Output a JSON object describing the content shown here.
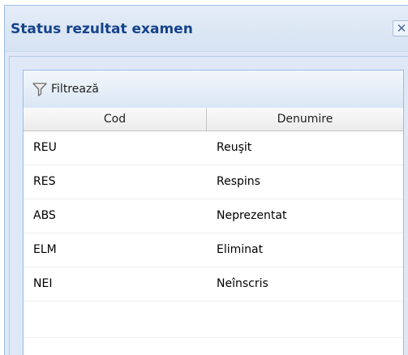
{
  "window": {
    "title": "Status rezultat examen",
    "close_glyph": "✕"
  },
  "toolbar": {
    "filter_label": "Filtrează",
    "filter_icon": "funnel-icon"
  },
  "grid": {
    "columns": [
      "Cod",
      "Denumire"
    ],
    "rows": [
      {
        "cod": "REU",
        "denumire": "Reuşit"
      },
      {
        "cod": "RES",
        "denumire": "Respins"
      },
      {
        "cod": "ABS",
        "denumire": "Neprezentat"
      },
      {
        "cod": "ELM",
        "denumire": "Eliminat"
      },
      {
        "cod": "NEI",
        "denumire": "Neînscris"
      }
    ]
  },
  "colors": {
    "title": "#15428b",
    "frame": "#dfe8f6",
    "border": "#99bbe8"
  }
}
